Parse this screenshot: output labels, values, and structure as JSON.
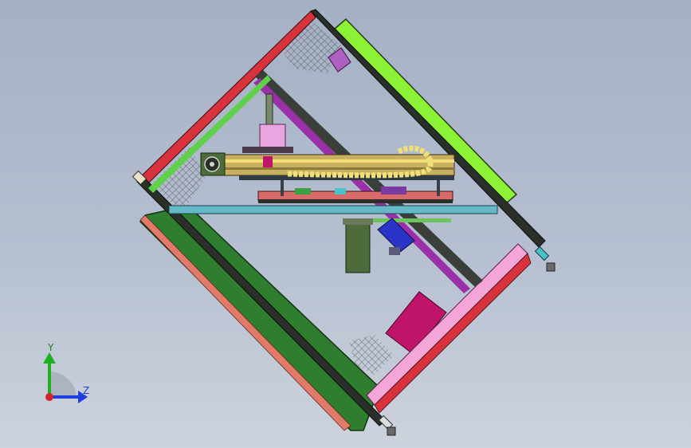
{
  "viewport": {
    "background_top": "#a4b0c4",
    "background_bottom": "#cdd3dd"
  },
  "model": {
    "colors": {
      "frame_dark": "#2a2f2a",
      "frame_red": "#d8323c",
      "frame_pink": "#f4a6d8",
      "panel_green": "#2f7d2f",
      "panel_lime": "#8cf235",
      "panel_magenta": "#c0146a",
      "rail_teal": "#66b8c6",
      "rail_purple": "#9a2fa8",
      "motor_blue": "#2a34c8",
      "motor_olive": "#4e6b3c",
      "module_pink": "#e7a6df",
      "chain_yellow": "#f1df79",
      "mesh": "#6e6e6e"
    }
  },
  "triad": {
    "y_label": "Y",
    "z_label": "Z",
    "y_color": "#1fb11f",
    "z_color": "#1e3fdc",
    "x_color": "#d8222a"
  }
}
